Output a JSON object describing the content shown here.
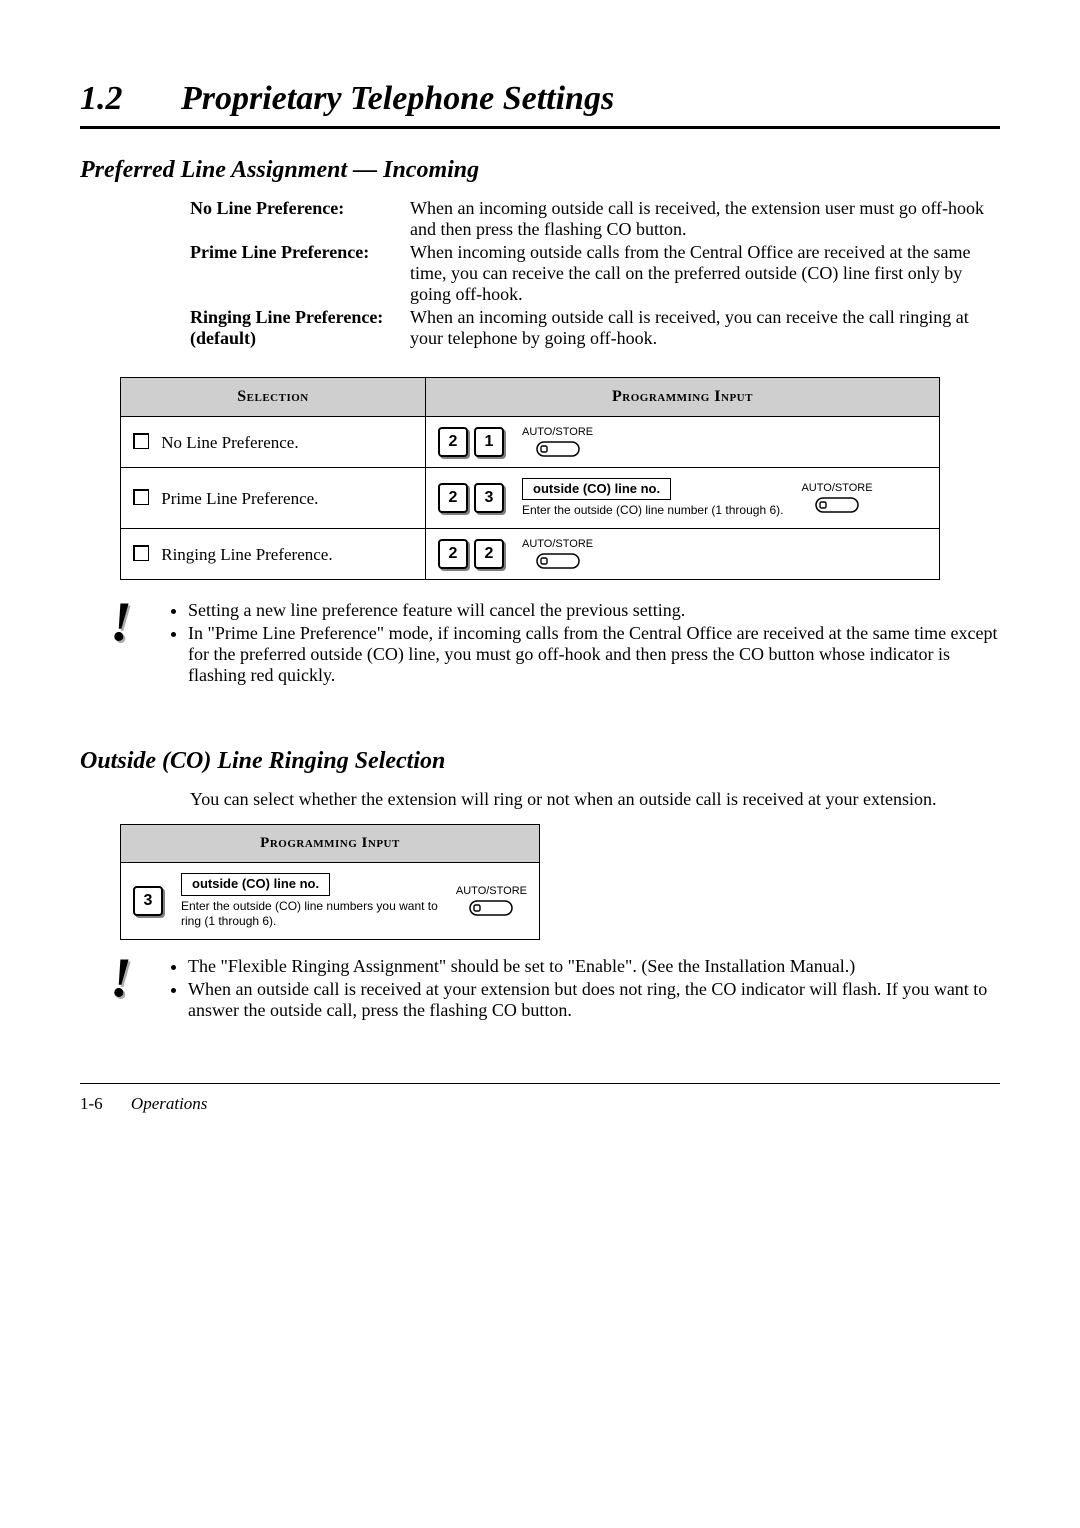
{
  "chapter": {
    "number": "1.2",
    "title": "Proprietary Telephone Settings"
  },
  "section1": {
    "title": "Preferred Line Assignment — Incoming",
    "defs": [
      {
        "label": "No Line Preference:",
        "text": "When an incoming outside call is received, the extension user must go off-hook and then press the flashing CO button."
      },
      {
        "label": "Prime Line Preference:",
        "text": "When incoming outside calls from the Central Office are received at the same time, you can receive the call on the preferred outside (CO) line first only by going off-hook."
      },
      {
        "label": "Ringing Line Preference: (default)",
        "text": "When an incoming outside call is received, you can receive the call ringing at your telephone by going off-hook."
      }
    ],
    "table": {
      "headers": {
        "selection": "Selection",
        "input": "Programming Input"
      },
      "rows": [
        {
          "label": "No Line Preference.",
          "keys": [
            "2",
            "1"
          ],
          "extra": null
        },
        {
          "label": "Prime Line Preference.",
          "keys": [
            "2",
            "3"
          ],
          "extra": {
            "title": "outside (CO) line no.",
            "hint": "Enter the outside (CO) line number (1 through 6)."
          }
        },
        {
          "label": "Ringing Line Preference.",
          "keys": [
            "2",
            "2"
          ],
          "extra": null
        }
      ]
    },
    "autostore_label": "AUTO/STORE",
    "notes": [
      "Setting a new line preference feature will cancel the previous setting.",
      "In \"Prime Line Preference\" mode, if incoming calls from the Central Office are received at the same time except for the preferred outside (CO) line, you must go off-hook and then press the CO button whose indicator is flashing red quickly."
    ]
  },
  "section2": {
    "title": "Outside (CO) Line Ringing Selection",
    "intro": "You can select whether the extension will ring or not when an outside call is received at your extension.",
    "table": {
      "header": "Programming Input",
      "row": {
        "keys": [
          "3"
        ],
        "extra": {
          "title": "outside (CO) line no.",
          "hint": "Enter the outside (CO) line numbers you want to ring (1 through 6)."
        }
      }
    },
    "notes": [
      "The \"Flexible Ringing Assignment\" should be set to \"Enable\". (See the Installation Manual.)",
      "When an outside call is received at your extension but does not ring, the CO indicator will flash. If you want to answer the outside call, press the flashing CO button."
    ]
  },
  "footer": {
    "page": "1-6",
    "section": "Operations"
  }
}
